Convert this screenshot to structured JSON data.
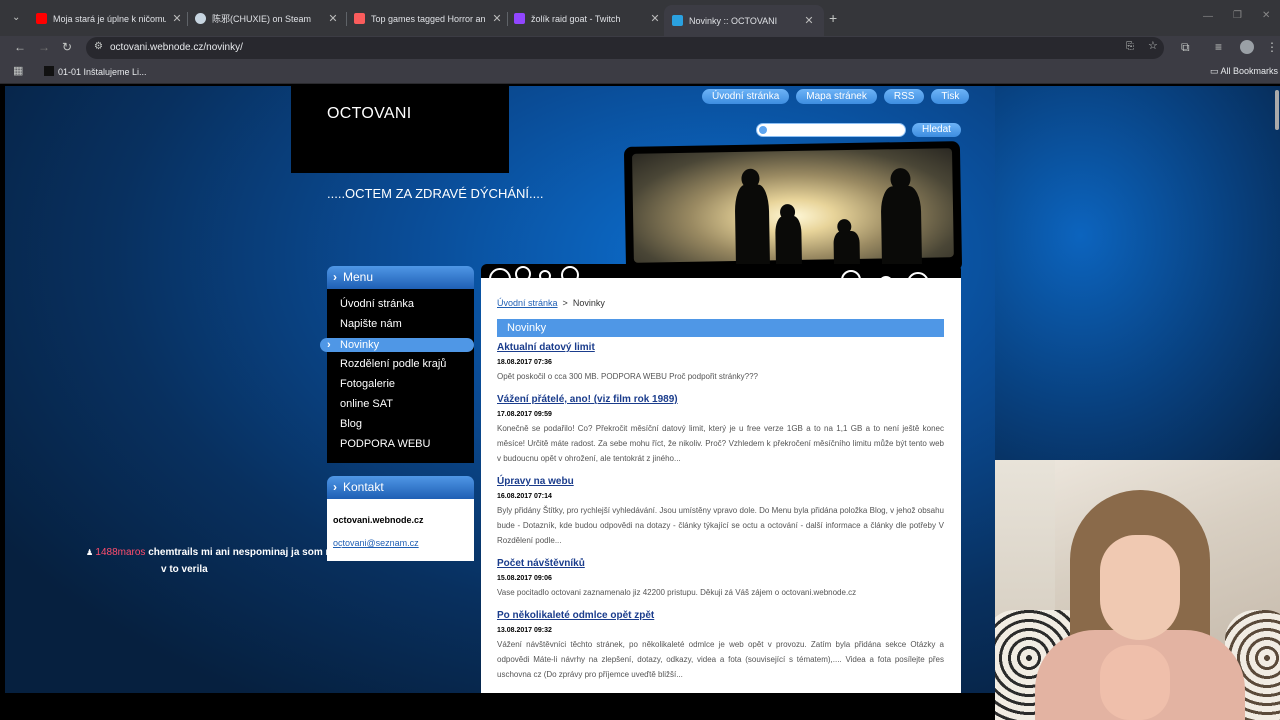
{
  "browser": {
    "tabs": [
      {
        "title": "Moja stará je úplne k ničomu -",
        "color": "#ff0000"
      },
      {
        "title": "陈邪(CHUXIE) on Steam",
        "color": "#1b2838"
      },
      {
        "title": "Top games tagged Horror and",
        "color": "#fa5c5c"
      },
      {
        "title": "žolík raid goat - Twitch",
        "color": "#9146ff"
      },
      {
        "title": "Novinky :: OCTOVANI",
        "color": "#2aa1e0"
      }
    ],
    "address": "octovani.webnode.cz/novinky/",
    "bookmark": "01-01 Inštalujeme Li...",
    "all_bookmarks": "All Bookmarks"
  },
  "site": {
    "logo": "OCTOVANI",
    "slogan": ".....OCTEM ZA ZDRAVÉ DÝCHÁNÍ....",
    "topnav": [
      "Úvodní stránka",
      "Mapa stránek",
      "RSS",
      "Tisk"
    ],
    "search_button": "Hledat",
    "menu_title": "Menu",
    "menu": [
      "Úvodní stránka",
      "Napište nám",
      "Novinky",
      "Rozdělení podle krajů",
      "Fotogalerie",
      "online SAT",
      "Blog",
      "PODPORA WEBU"
    ],
    "menu_active_index": 2,
    "kontakt_title": "Kontakt",
    "kontakt_name": "octovani.webnode.cz",
    "kontakt_email": "octovani@seznam.cz",
    "breadcrumb_home": "Úvodní stránka",
    "breadcrumb_sep": ">",
    "breadcrumb_current": "Novinky",
    "section_title": "Novinky",
    "articles": [
      {
        "title": "Aktualní datový limit",
        "date": "18.08.2017 07:36",
        "text": "Opět poskočil o cca 300 MB.  PODPORA WEBU Proč podpořit stránky???"
      },
      {
        "title": "Vážení přátelé, ano! (viz film rok 1989)",
        "date": "17.08.2017 09:59",
        "text": "Konečně se podařilo! Co? Překročit měsíční datový limit, který je u free verze 1GB a to na 1,1 GB a to není ještě konec měsíce! Určitě máte radost. Za sebe mohu říct, že nikoliv. Proč? Vzhledem k překročení měsíčního limitu může být tento web v budoucnu opět v ohrožení, ale tentokrát z jiného..."
      },
      {
        "title": "Úpravy na webu",
        "date": "16.08.2017 07:14",
        "text": "Byly přidány Štítky, pro rychlejší vyhledávání. Jsou umístěny vpravo dole.   Do Menu byla přidána položka Blog, v jehož obsahu bude  - Dotazník, kde budou odpovědi na dotazy - články týkající se octu a octování  - další informace a články dle potřeby   V Rozdělení podle..."
      },
      {
        "title": "Počet návštěvníků",
        "date": "15.08.2017 09:06",
        "text": "Vase pocitadlo octovani zaznamenalo jiz 42200 pristupu. Děkuji zá Váš zájem o octovani.webnode.cz"
      },
      {
        "title": "Po několikaleté odmlce opět zpět",
        "date": "13.08.2017 09:32",
        "text": "Vážení návštěvníci těchto stránek, po několikaleté odmlce je web opět v provozu. Zatím byla přidána sekce Otázky a odpovědi Máte-li návrhy na zlepšení,  dotazy, odkazy, videa a fota (související s tématem),.... Videa a fota posílejte přes uschovna cz (Do zprávy pro příjemce uveďtě bližší..."
      }
    ]
  },
  "chat": {
    "user": "1488maros",
    "message_line1": "chemtrails mi ani nespominaj ja som mal znamu co",
    "message_line2": "v to verila"
  }
}
